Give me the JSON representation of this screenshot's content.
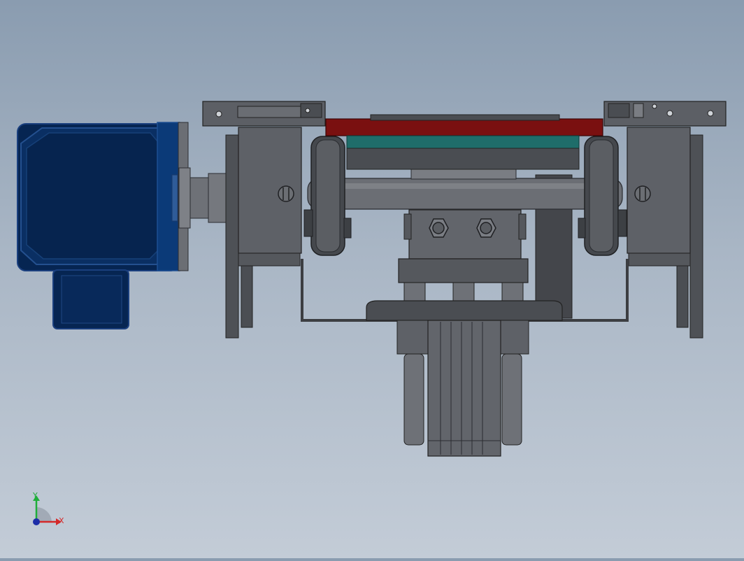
{
  "viewport": {
    "view": "front",
    "background_top": "#8a9cb0",
    "background_bottom": "#c3ccd7"
  },
  "triad": {
    "x_label": "X",
    "y_label": "Y",
    "x_color": "#d42a2a",
    "y_color": "#1fae3a",
    "z_color": "#1c2ea8"
  },
  "model": {
    "motor_color": "#062552",
    "plate_color": "#7a1010",
    "teal_layer_color": "#1f6d6a",
    "body_color": "#55585e"
  }
}
